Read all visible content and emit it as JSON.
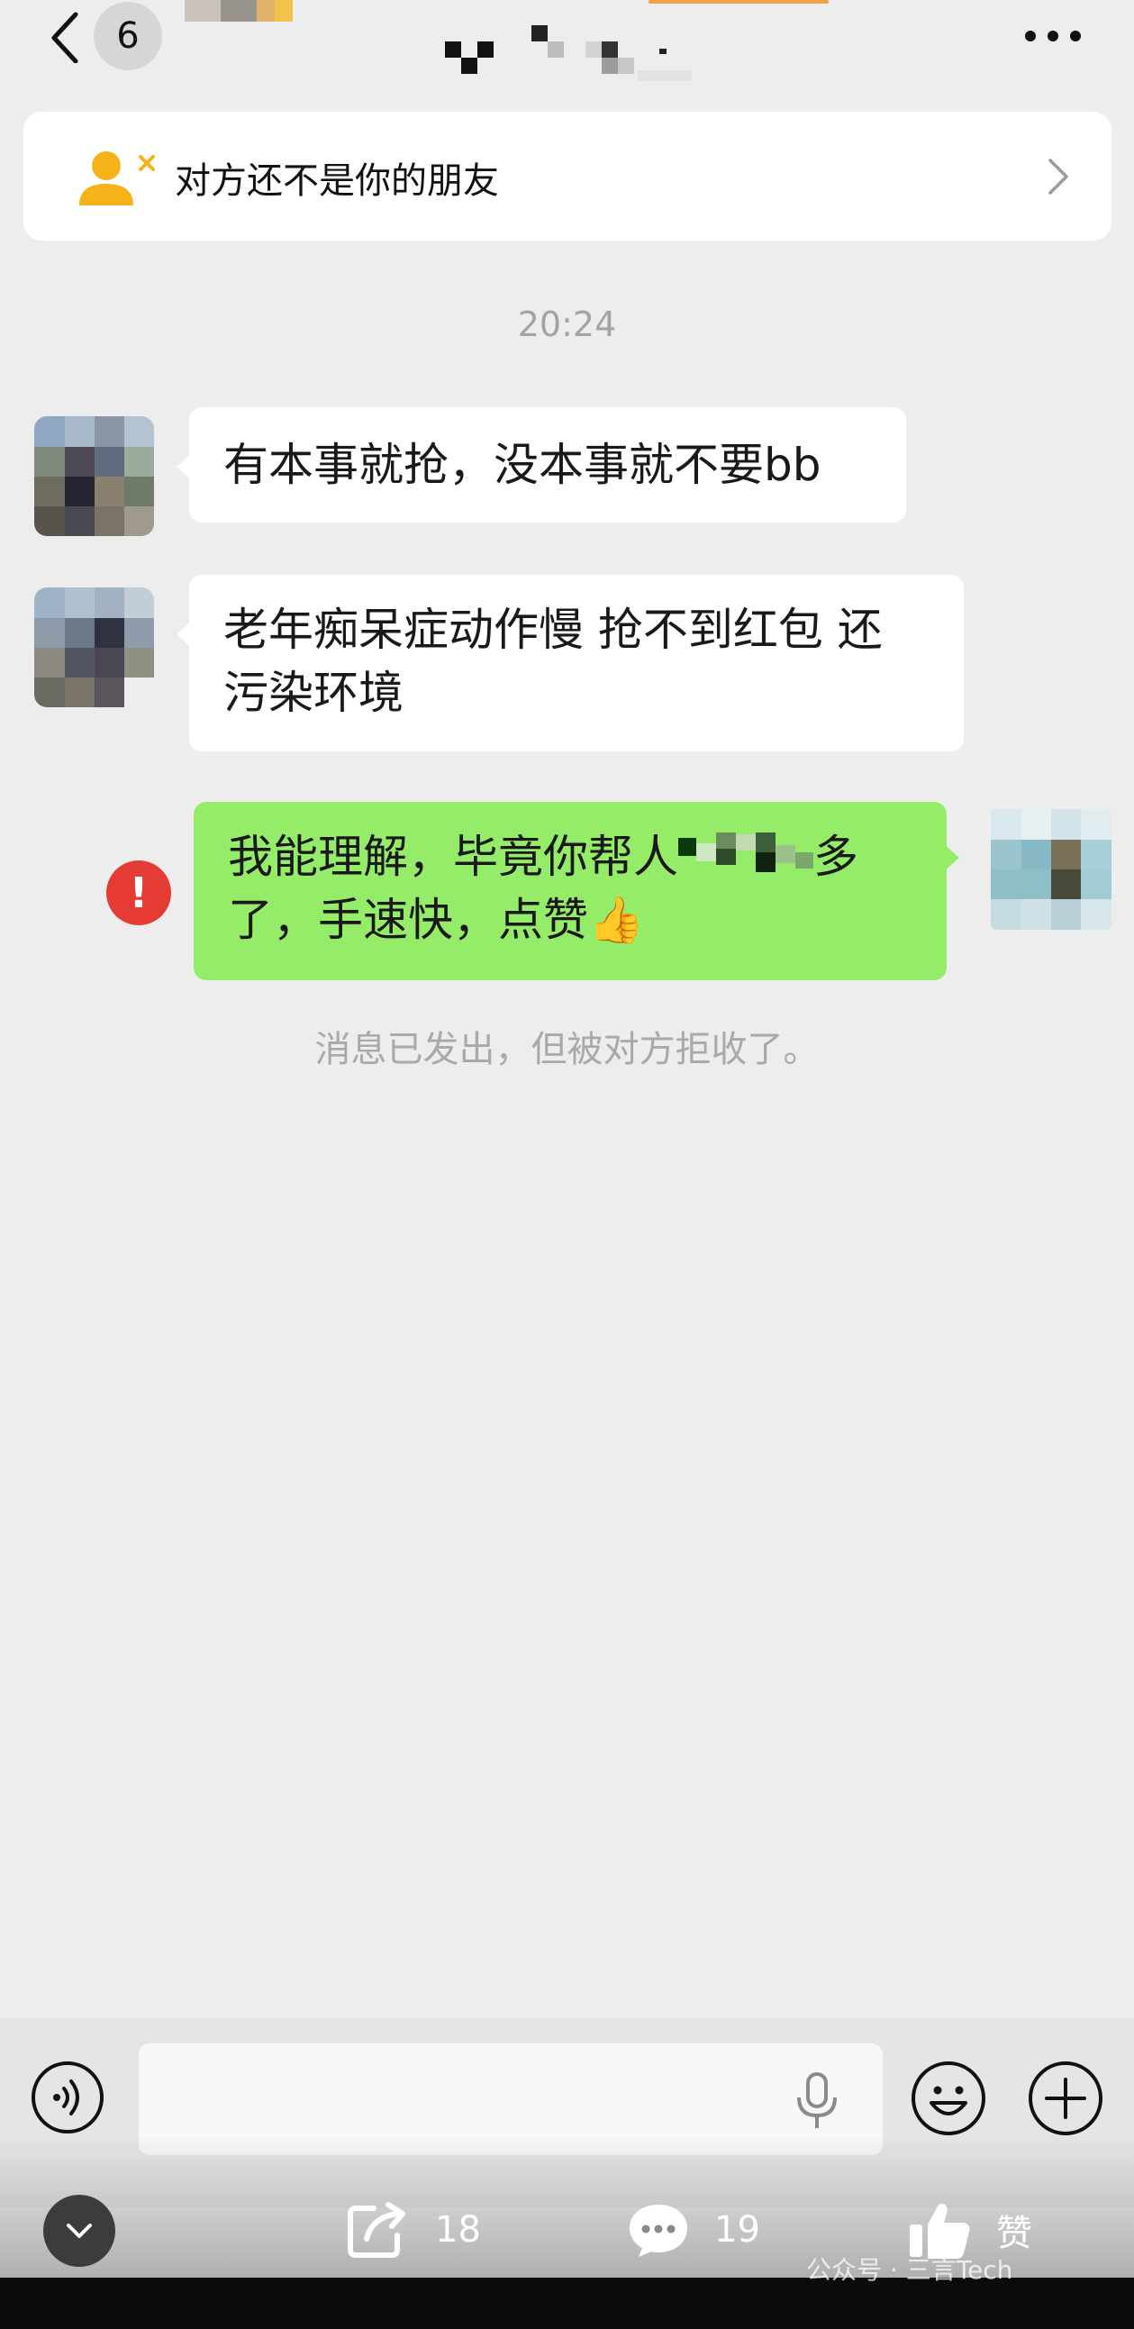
{
  "header": {
    "unread_count": "6"
  },
  "banner": {
    "text": "对方还不是你的朋友"
  },
  "timestamp": "20:24",
  "messages": [
    {
      "side": "left",
      "text": "有本事就抢，没本事就不要bb"
    },
    {
      "side": "left",
      "lines": [
        "老年痴呆症动作慢 抢不到红包 还",
        "污染环境"
      ]
    },
    {
      "side": "right",
      "line1_before": "我能理解，毕竟你帮人",
      "line1_after": "多",
      "line2": "了，手速快，点赞👍"
    }
  ],
  "system_note": "消息已发出，但被对方拒收了。",
  "bottom_bar": {
    "share_count": "18",
    "comment_count": "19",
    "like_label": "赞"
  },
  "watermark": "公众号 · 三言Tech",
  "colors": {
    "background": "#ededed",
    "bubble_self": "#95ec69",
    "bubble_other": "#ffffff",
    "error": "#e53b35",
    "banner_icon": "#f5b31a"
  },
  "icons": [
    "back-chevron-icon",
    "more-icon",
    "user-remove-icon",
    "chevron-right-icon",
    "error-icon",
    "voice-icon",
    "mic-icon",
    "emoji-icon",
    "plus-icon",
    "chevron-down-icon",
    "share-icon",
    "comment-icon",
    "like-icon"
  ]
}
